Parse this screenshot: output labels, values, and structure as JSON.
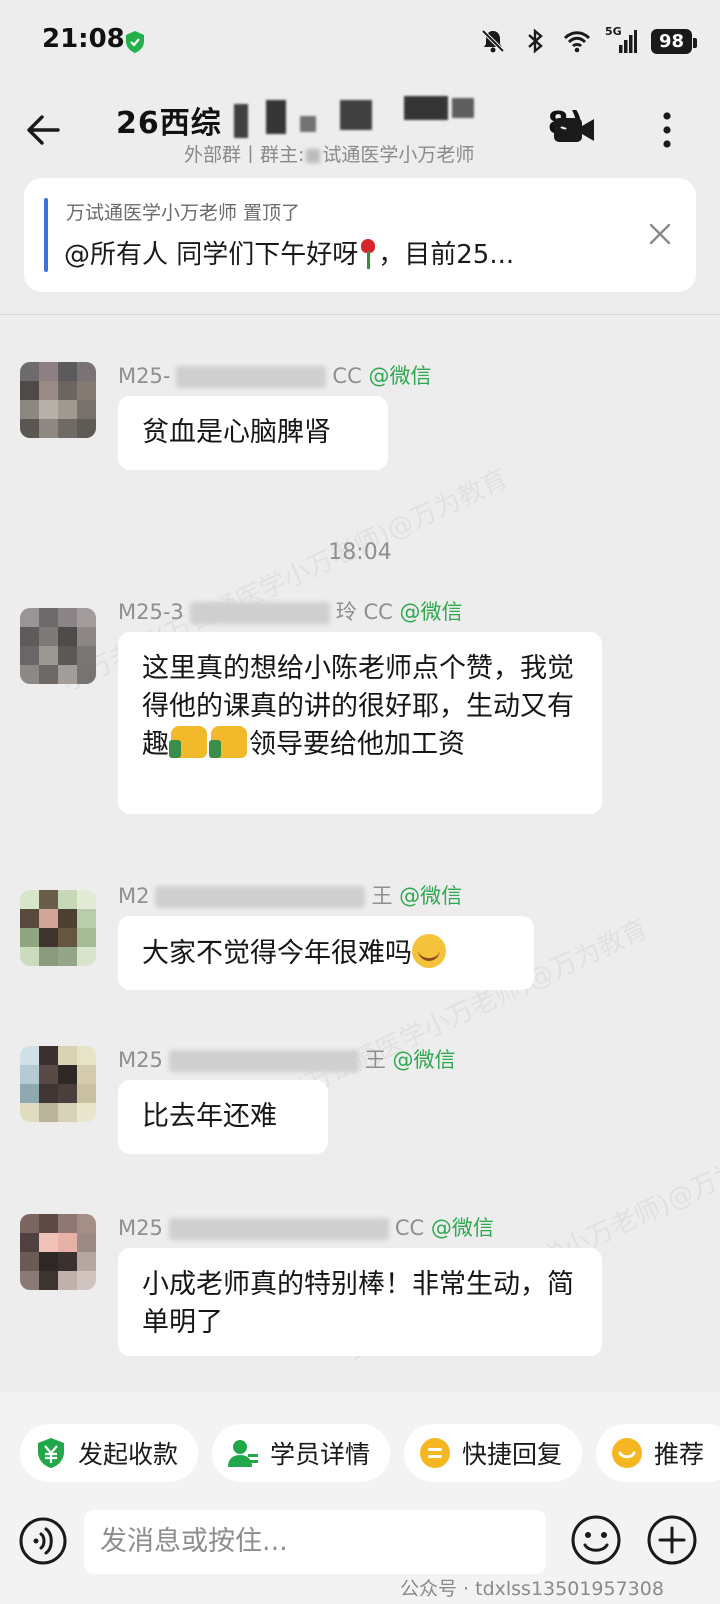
{
  "status_bar": {
    "time": "21:08",
    "network": "5G",
    "battery": "98"
  },
  "header": {
    "title_prefix": "26西综",
    "title_suffix": "8)",
    "subtitle": "外部群丨群主:",
    "subtitle_tail": "试通医学小万老师"
  },
  "pinned": {
    "meta": "万试通医学小万老师 置顶了",
    "text_a": "@所有人  同学们下午好呀",
    "text_b": "，目前25..."
  },
  "messages": [
    {
      "sender_prefix": "M25-",
      "sender_tail": "CC",
      "source": "@微信",
      "text": "贫血是心脑脾肾"
    },
    {
      "sender_prefix": "M25-3",
      "sender_tail": "玲 CC",
      "source": "@微信",
      "text_a": "这里真的想给小陈老师点个赞，我觉得他的课真的讲的很好耶，生动又有趣",
      "text_b": "领导要给他加工资"
    },
    {
      "sender_prefix": "M2",
      "sender_tail": "王",
      "source": "@微信",
      "text": "大家不觉得今年很难吗"
    },
    {
      "sender_prefix": "M25",
      "sender_tail": "王",
      "source": "@微信",
      "text": "比去年还难"
    },
    {
      "sender_prefix": "M25",
      "sender_tail": "CC",
      "source": "@微信",
      "text": "小成老师真的特别棒！非常生动，简单明了"
    }
  ],
  "timestamp": "18:04",
  "watermark_text": "小万老师(万试通医学小万老师)@万为教育",
  "quick_actions": [
    {
      "label": "发起收款",
      "icon": "payment-icon"
    },
    {
      "label": "学员详情",
      "icon": "student-icon"
    },
    {
      "label": "快捷回复",
      "icon": "quick-reply-icon"
    },
    {
      "label": "推荐",
      "icon": "recommend-icon"
    }
  ],
  "input": {
    "placeholder": "发消息或按住..."
  },
  "footer_watermark": "公众号 · tdxlss13501957308",
  "colors": {
    "accent_green": "#2fa84f",
    "pin_bar_blue": "#3b73d9",
    "background": "#ededed"
  }
}
